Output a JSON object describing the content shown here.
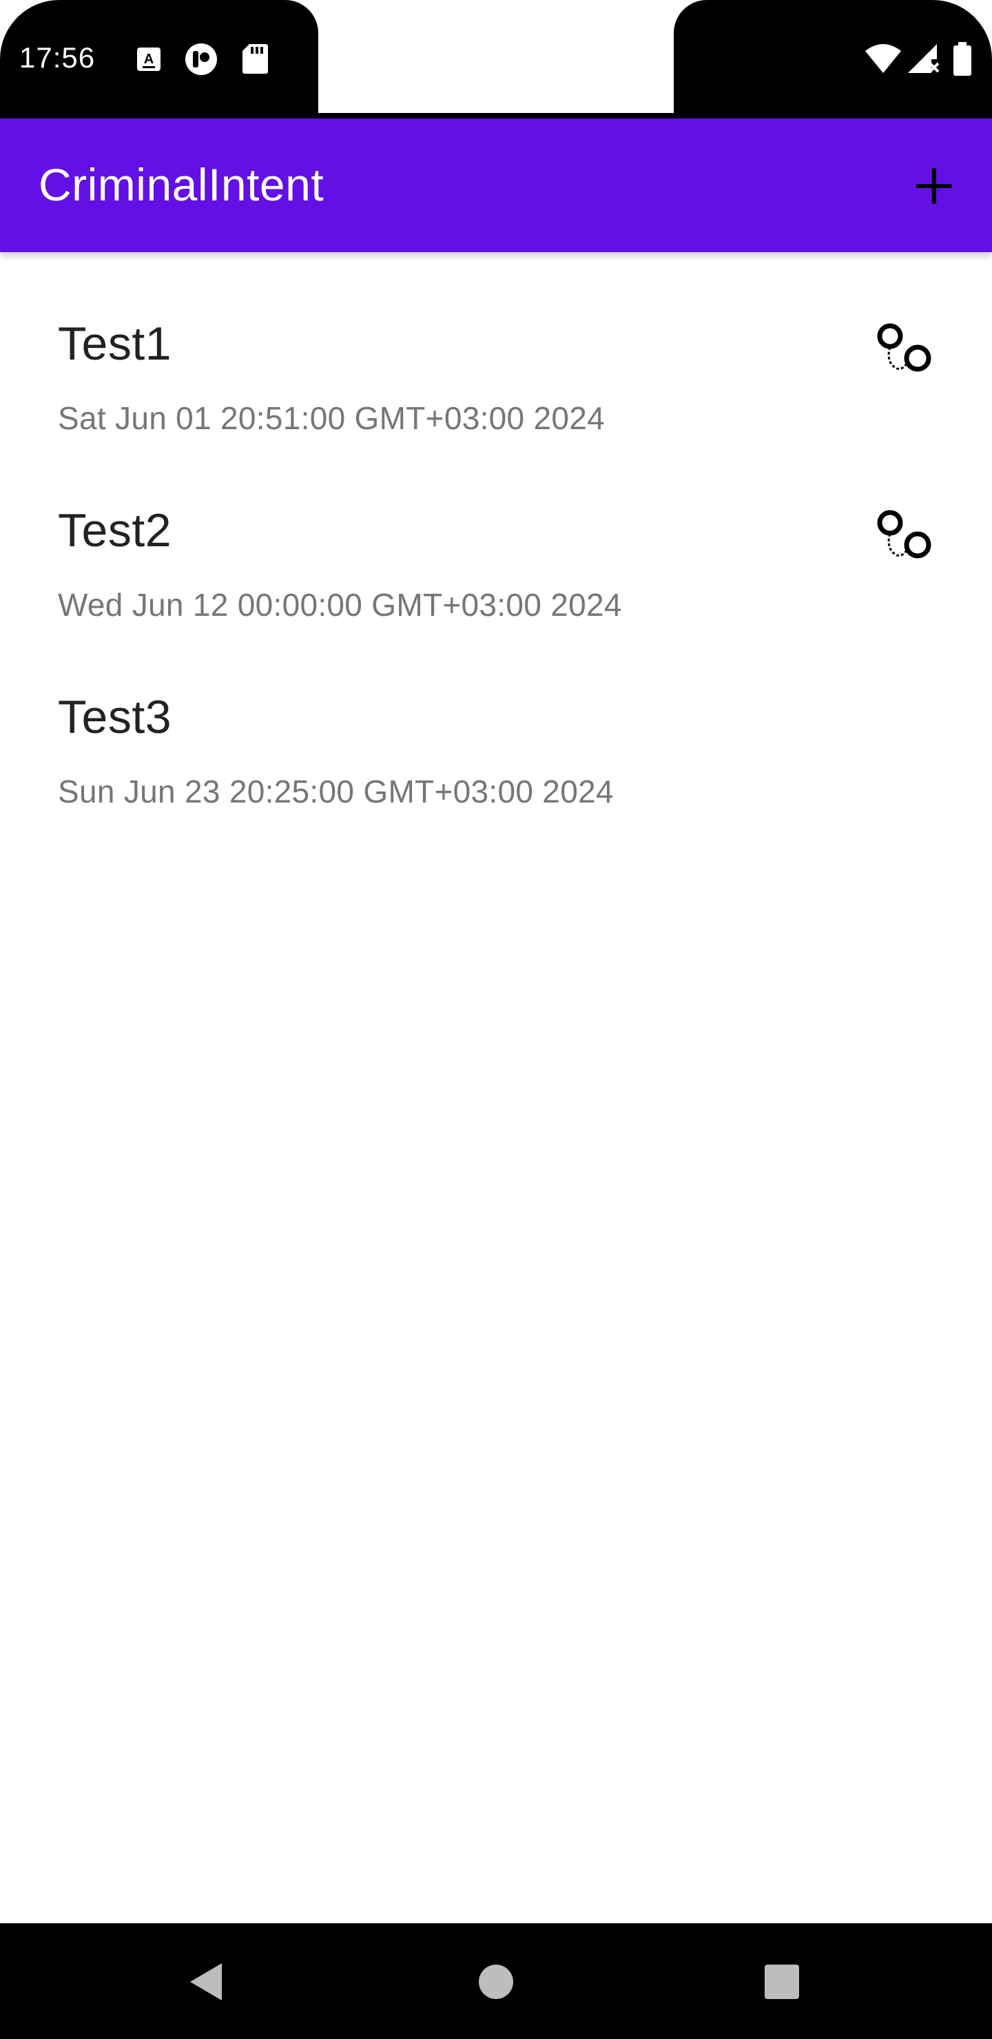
{
  "status_bar": {
    "time": "17:56",
    "left_icons": [
      "a-icon",
      "circle-app-icon",
      "sd-card-icon"
    ],
    "right_icons": [
      "wifi-icon",
      "signal-icon",
      "battery-icon"
    ]
  },
  "app_bar": {
    "title": "CriminalIntent",
    "add_icon": "plus-icon",
    "background": "#6210e6"
  },
  "crimes": [
    {
      "title": "Test1",
      "date": "Sat Jun 01 20:51:00 GMT+03:00 2024",
      "solved": true
    },
    {
      "title": "Test2",
      "date": "Wed Jun 12 00:00:00 GMT+03:00 2024",
      "solved": true
    },
    {
      "title": "Test3",
      "date": "Sun Jun 23 20:25:00 GMT+03:00 2024",
      "solved": false
    }
  ],
  "nav_bar": {
    "icons": [
      "back-icon",
      "home-icon",
      "recents-icon"
    ]
  }
}
